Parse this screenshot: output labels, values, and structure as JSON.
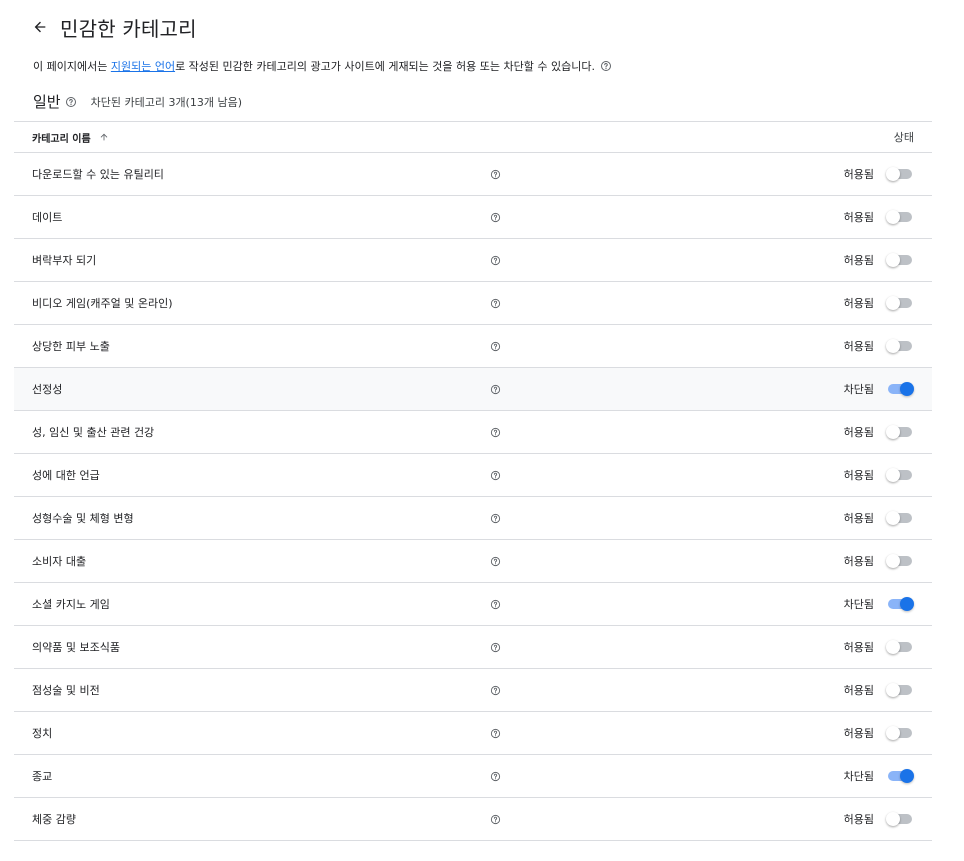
{
  "header": {
    "title": "민감한 카테고리",
    "back_icon": "arrow-back-icon"
  },
  "description": {
    "prefix": "이 페이지에서는 ",
    "link_text": "지원되는 언어",
    "suffix": "로 작성된 민감한 카테고리의 광고가 사이트에 게재되는 것을 허용 또는 차단할 수 있습니다."
  },
  "section": {
    "title": "일반",
    "subtitle": "차단된 카테고리 3개(13개 남음)"
  },
  "table": {
    "column_name": "카테고리 이름",
    "column_status": "상태",
    "rows": [
      {
        "name": "다운로드할 수 있는 유틸리티",
        "status": "허용됨",
        "blocked": false
      },
      {
        "name": "데이트",
        "status": "허용됨",
        "blocked": false
      },
      {
        "name": "벼락부자 되기",
        "status": "허용됨",
        "blocked": false
      },
      {
        "name": "비디오 게임(캐주얼 및 온라인)",
        "status": "허용됨",
        "blocked": false
      },
      {
        "name": "상당한 피부 노출",
        "status": "허용됨",
        "blocked": false
      },
      {
        "name": "선정성",
        "status": "차단됨",
        "blocked": true
      },
      {
        "name": "성, 임신 및 출산 관련 건강",
        "status": "허용됨",
        "blocked": false
      },
      {
        "name": "성에 대한 언급",
        "status": "허용됨",
        "blocked": false
      },
      {
        "name": "성형수술 및 체형 변형",
        "status": "허용됨",
        "blocked": false
      },
      {
        "name": "소비자 대출",
        "status": "허용됨",
        "blocked": false
      },
      {
        "name": "소셜 카지노 게임",
        "status": "차단됨",
        "blocked": true
      },
      {
        "name": "의약품 및 보조식품",
        "status": "허용됨",
        "blocked": false
      },
      {
        "name": "점성술 및 비전",
        "status": "허용됨",
        "blocked": false
      },
      {
        "name": "정치",
        "status": "허용됨",
        "blocked": false
      },
      {
        "name": "종교",
        "status": "차단됨",
        "blocked": true
      },
      {
        "name": "체중 감량",
        "status": "허용됨",
        "blocked": false
      }
    ]
  },
  "colors": {
    "accent": "#1a73e8",
    "toggle_on_track": "#8ab4f8",
    "toggle_off_track": "#bdc1c6",
    "divider": "#dadce0"
  }
}
